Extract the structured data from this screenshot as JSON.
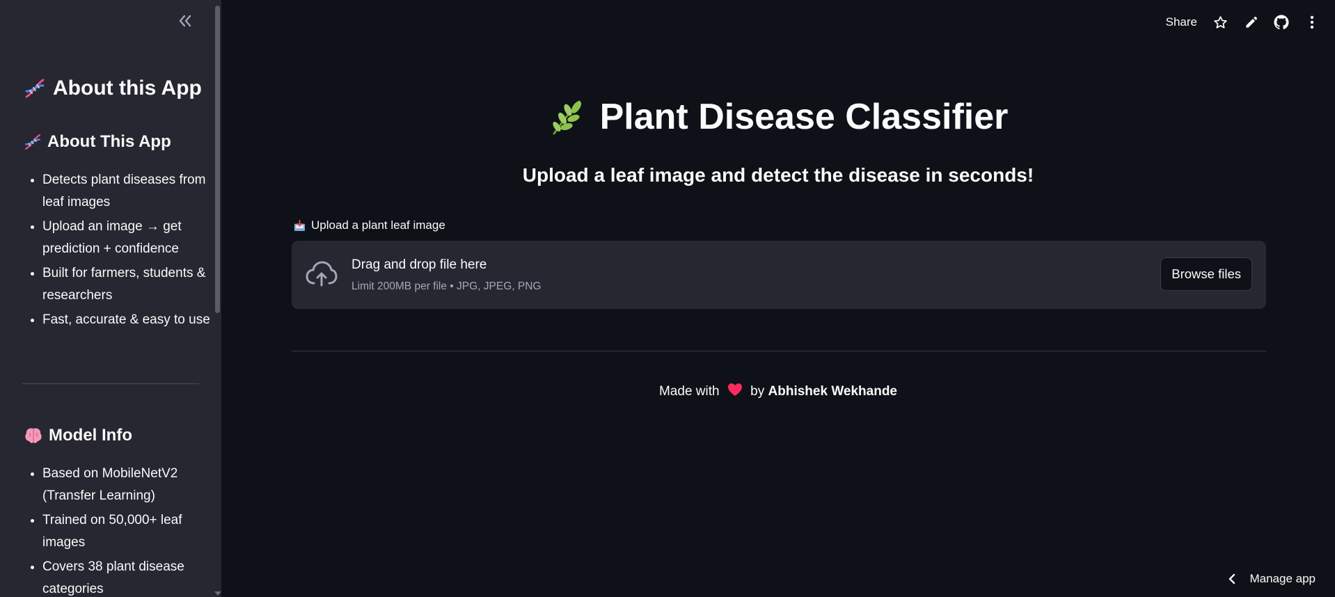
{
  "sidebar": {
    "header": "About this App",
    "about_heading": "About This App",
    "about_items": [
      "Detects plant diseases from leaf images",
      "Upload an image → get prediction + confidence",
      "Built for farmers, students & researchers",
      "Fast, accurate & easy to use"
    ],
    "model_heading": "Model Info",
    "model_items": [
      "Based on MobileNetV2 (Transfer Learning)",
      "Trained on 50,000+ leaf images",
      "Covers 38 plant disease categories"
    ]
  },
  "toolbar": {
    "share_label": "Share"
  },
  "main": {
    "title": "Plant Disease Classifier",
    "subtitle": "Upload a leaf image and detect the disease in seconds!",
    "uploader": {
      "label": "Upload a plant leaf image",
      "drop_text": "Drag and drop file here",
      "limit_text": "Limit 200MB per file • JPG, JPEG, PNG",
      "browse_label": "Browse files"
    },
    "footer": {
      "prefix": "Made with",
      "by": "by",
      "author": "Abhishek Wekhande"
    }
  },
  "manage_app_label": "Manage app",
  "colors": {
    "background": "#0e1117",
    "sidebar": "#262730",
    "text": "#fafafa",
    "muted_text": "#a3a8b8",
    "heart": "#ff2b5e"
  },
  "icons": [
    "dna-icon",
    "leaf-icon",
    "brain-icon",
    "inbox-icon",
    "cloud-upload-icon",
    "heart-icon",
    "star-icon",
    "pencil-icon",
    "github-icon",
    "more-vertical-icon",
    "chevron-left-icon",
    "double-chevron-left-icon"
  ]
}
